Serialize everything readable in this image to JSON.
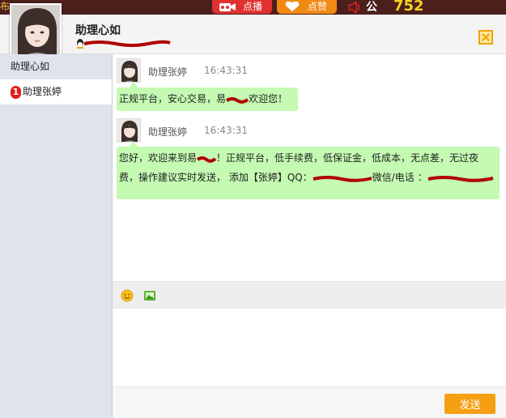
{
  "topbar": {
    "edge_char": "布",
    "live_label": "点播",
    "like_label": "点赞",
    "notice_label": "公告:",
    "notice_count": "752"
  },
  "header": {
    "contact_name": "助理心如"
  },
  "sidebar": {
    "items": [
      {
        "label": "助理心如"
      },
      {
        "label": "助理张婷",
        "unread": "1"
      }
    ]
  },
  "messages": [
    {
      "sender": "助理张婷",
      "time": "16:43:31",
      "text": "正规平台，安心交易，易",
      "text_after_redaction": "欢迎您！"
    },
    {
      "sender": "助理张婷",
      "time": "16:43:31",
      "line1_a": "您好，欢迎来到易",
      "line1_b": "！正规平台，低手续费，低保证金，低成本，无点差，无过夜",
      "line2_a": "费，操作建议实时发送， 添加【张婷】QQ：",
      "line2_b": "微信/电话 ："
    }
  ],
  "composer": {
    "send_label": "发送"
  },
  "colors": {
    "accent_orange": "#f5a013",
    "bubble_green": "#c4fab2",
    "badge_red": "#e21b1b",
    "live_red": "#e03030",
    "like_orange": "#f08a14",
    "redaction_red": "#b00000"
  },
  "icons": {
    "live": "camera-icon",
    "like": "heart-icon",
    "notice": "speaker-icon",
    "close": "close-icon",
    "emoji": "smiley-icon",
    "image": "image-icon",
    "qq": "qq-icon"
  }
}
